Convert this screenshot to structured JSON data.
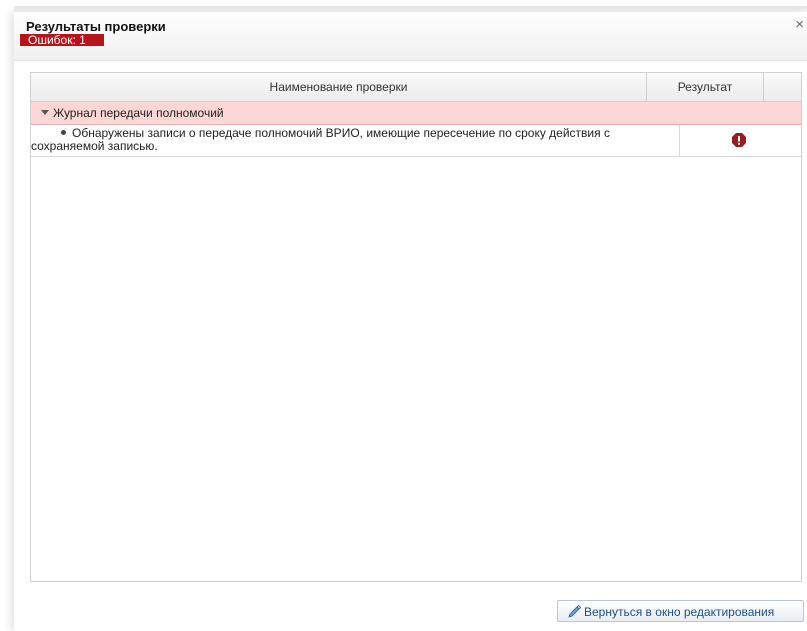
{
  "dialog": {
    "title": "Результаты проверки",
    "error_badge": "Ошибок: 1",
    "close_glyph": "×"
  },
  "table": {
    "columns": [
      "Наименование проверки",
      "Результат"
    ],
    "groups": [
      {
        "label": "Журнал передачи полномочий",
        "expanded": true,
        "rows": [
          {
            "text_line1": "Обнаружены записи о передаче полномочий ВРИО, имеющие пересечение по сроку действия с",
            "text_line2": "сохраняемой записью.",
            "result_icon": "error-icon"
          }
        ]
      }
    ]
  },
  "footer": {
    "back_button_label": "Вернуться в окно редактирования",
    "back_button_icon": "pencil-icon"
  },
  "colors": {
    "badge": "#b7131b",
    "group_row": "#fdd6d6",
    "error_icon": "#9b1b22",
    "button_text": "#1f4f86"
  }
}
